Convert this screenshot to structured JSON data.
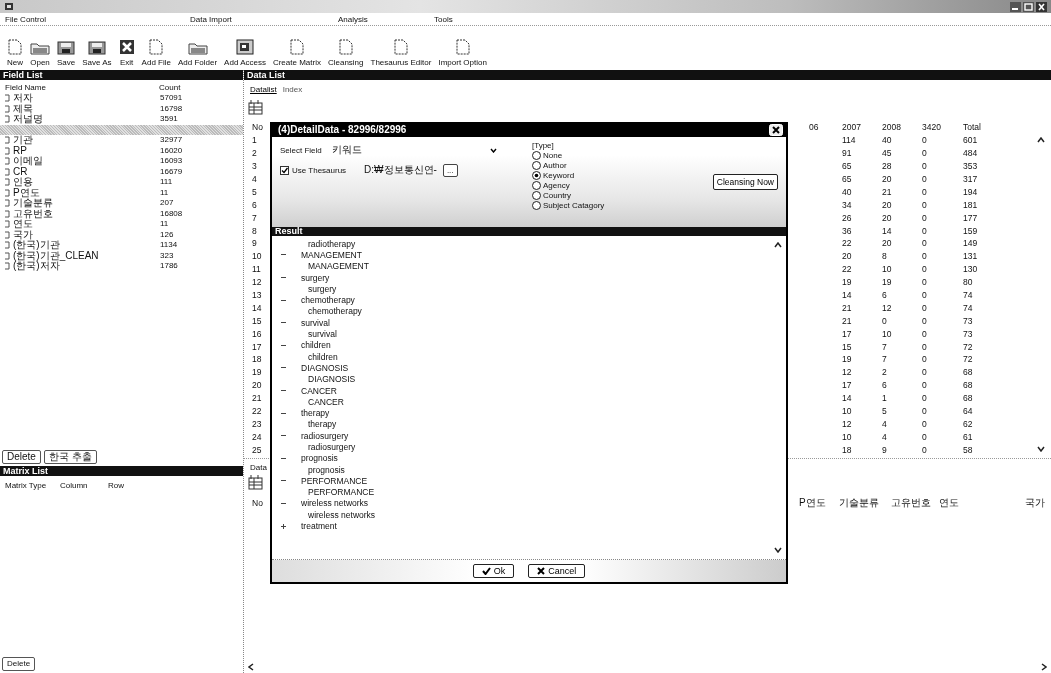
{
  "menu": [
    "File Control",
    "Data Import",
    "Analysis",
    "Tools"
  ],
  "toolbar": [
    {
      "label": "New",
      "kind": "document"
    },
    {
      "label": "Open",
      "kind": "folder"
    },
    {
      "label": "Save",
      "kind": "disk"
    },
    {
      "label": "Save As",
      "kind": "disk"
    },
    {
      "label": "Exit",
      "kind": "exit"
    },
    {
      "label": "Add File",
      "kind": "document"
    },
    {
      "label": "Add Folder",
      "kind": "folder"
    },
    {
      "label": "Add Access",
      "kind": "database"
    },
    {
      "label": "Create Matrix",
      "kind": "document"
    },
    {
      "label": "Cleansing",
      "kind": "document"
    },
    {
      "label": "Thesaurus Editor",
      "kind": "document"
    },
    {
      "label": "Import Option",
      "kind": "document"
    }
  ],
  "field_list": {
    "title": "Field List",
    "columns": [
      "Field Name",
      "Count"
    ],
    "rows": [
      {
        "name": "저자",
        "count": "57091",
        "selected": false
      },
      {
        "name": "제목",
        "count": "16798",
        "selected": false
      },
      {
        "name": "저널명",
        "count": "3591",
        "selected": false
      },
      {
        "selected": true
      },
      {
        "name": "기관",
        "count": "32977",
        "selected": false
      },
      {
        "name": "RP",
        "count": "16020",
        "selected": false
      },
      {
        "name": "이메일",
        "count": "16093",
        "selected": false
      },
      {
        "name": "CR",
        "count": "16679",
        "selected": false
      },
      {
        "name": "인용",
        "count": "111",
        "selected": false
      },
      {
        "name": "P연도",
        "count": "11",
        "selected": false
      },
      {
        "name": "기술분류",
        "count": "207",
        "selected": false
      },
      {
        "name": "고유번호",
        "count": "16808",
        "selected": false
      },
      {
        "name": "연도",
        "count": "11",
        "selected": false
      },
      {
        "name": "국가",
        "count": "126",
        "selected": false
      },
      {
        "name": "(한국)기관",
        "count": "1134",
        "selected": false
      },
      {
        "name": "(한국)기관_CLEAN",
        "count": "323",
        "selected": false
      },
      {
        "name": "(한국)저자",
        "count": "1786",
        "selected": false
      }
    ],
    "buttons": [
      "Delete",
      "한국 추출"
    ]
  },
  "matrix_list": {
    "title": "Matrix List",
    "columns": [
      "Matrix Type",
      "Column",
      "Row"
    ],
    "buttons": [
      "Delete"
    ]
  },
  "data_list": {
    "title": "Data List",
    "tabs": [
      {
        "label": "Datalist",
        "selected": true
      },
      {
        "label": "Index",
        "selected": false
      }
    ],
    "table": {
      "no_column": "No",
      "columns": [
        "06",
        "2007",
        "2008",
        "3420",
        "Total"
      ],
      "rows": [
        {
          "no": "1",
          "cells": [
            "",
            "114",
            "40",
            "0",
            "601"
          ]
        },
        {
          "no": "2",
          "cells": [
            "",
            "91",
            "45",
            "0",
            "484"
          ]
        },
        {
          "no": "3",
          "cells": [
            "",
            "65",
            "28",
            "0",
            "353"
          ]
        },
        {
          "no": "4",
          "cells": [
            "",
            "65",
            "20",
            "0",
            "317"
          ]
        },
        {
          "no": "5",
          "cells": [
            "",
            "40",
            "21",
            "0",
            "194"
          ]
        },
        {
          "no": "6",
          "cells": [
            "",
            "34",
            "20",
            "0",
            "181"
          ]
        },
        {
          "no": "7",
          "cells": [
            "",
            "26",
            "20",
            "0",
            "177"
          ]
        },
        {
          "no": "8",
          "cells": [
            "",
            "36",
            "14",
            "0",
            "159"
          ]
        },
        {
          "no": "9",
          "cells": [
            "",
            "22",
            "20",
            "0",
            "149"
          ]
        },
        {
          "no": "10",
          "cells": [
            "",
            "20",
            "8",
            "0",
            "131"
          ]
        },
        {
          "no": "11",
          "cells": [
            "",
            "22",
            "10",
            "0",
            "130"
          ]
        },
        {
          "no": "12",
          "cells": [
            "",
            "19",
            "19",
            "0",
            "80"
          ]
        },
        {
          "no": "13",
          "cells": [
            "",
            "14",
            "6",
            "0",
            "74"
          ]
        },
        {
          "no": "14",
          "cells": [
            "",
            "21",
            "12",
            "0",
            "74"
          ]
        },
        {
          "no": "15",
          "cells": [
            "",
            "21",
            "0",
            "0",
            "73"
          ]
        },
        {
          "no": "16",
          "cells": [
            "",
            "17",
            "10",
            "0",
            "73"
          ]
        },
        {
          "no": "17",
          "cells": [
            "",
            "15",
            "7",
            "0",
            "72"
          ]
        },
        {
          "no": "18",
          "cells": [
            "",
            "19",
            "7",
            "0",
            "72"
          ]
        },
        {
          "no": "19",
          "cells": [
            "",
            "12",
            "2",
            "0",
            "68"
          ]
        },
        {
          "no": "20",
          "cells": [
            "",
            "17",
            "6",
            "0",
            "68"
          ]
        },
        {
          "no": "21",
          "cells": [
            "",
            "14",
            "1",
            "0",
            "68"
          ]
        },
        {
          "no": "22",
          "cells": [
            "",
            "10",
            "5",
            "0",
            "64"
          ]
        },
        {
          "no": "23",
          "cells": [
            "",
            "12",
            "4",
            "0",
            "62"
          ]
        },
        {
          "no": "24",
          "cells": [
            "",
            "10",
            "4",
            "0",
            "61"
          ]
        },
        {
          "no": "25",
          "cells": [
            "",
            "18",
            "9",
            "0",
            "58"
          ]
        }
      ]
    },
    "second_table": {
      "label": "Data",
      "columns_left": [
        "No"
      ],
      "columns_right": [
        "P연도",
        "기술분류",
        "고유번호",
        "연도",
        "국가"
      ]
    }
  },
  "dialog": {
    "title": "(4)DetailData - 82996/82996",
    "select_field": {
      "label": "Select Field",
      "value": "키워드"
    },
    "use_thesaurus": {
      "label": "Use Thesaurus",
      "checked": true
    },
    "thesaurus_path": "D:₩정보통신연-",
    "browse_button": "...",
    "type_group": {
      "label": "[Type]",
      "options": [
        {
          "label": "None",
          "selected": false
        },
        {
          "label": "Author",
          "selected": false
        },
        {
          "label": "Keyword",
          "selected": true
        },
        {
          "label": "Agency",
          "selected": false
        },
        {
          "label": "Country",
          "selected": false
        },
        {
          "label": "Subject Catagory",
          "selected": false
        }
      ]
    },
    "cleansing_button": "Cleansing Now",
    "result_title": "Result",
    "tree": [
      {
        "children": [
          {
            "label": "radiotherapy"
          }
        ]
      },
      {
        "label": "MANAGEMENT",
        "expanded": true,
        "children": [
          {
            "label": "MANAGEMENT"
          }
        ]
      },
      {
        "label": "surgery",
        "expanded": true,
        "children": [
          {
            "label": "surgery"
          }
        ]
      },
      {
        "label": "chemotherapy",
        "expanded": true,
        "children": [
          {
            "label": "chemotherapy"
          }
        ]
      },
      {
        "label": "survival",
        "expanded": true,
        "children": [
          {
            "label": "survival"
          }
        ]
      },
      {
        "label": "children",
        "expanded": true,
        "children": [
          {
            "label": "children"
          }
        ]
      },
      {
        "label": "DIAGNOSIS",
        "expanded": true,
        "children": [
          {
            "label": "DIAGNOSIS"
          }
        ]
      },
      {
        "label": "CANCER",
        "expanded": true,
        "children": [
          {
            "label": "CANCER"
          }
        ]
      },
      {
        "label": "therapy",
        "expanded": true,
        "children": [
          {
            "label": "therapy"
          }
        ]
      },
      {
        "label": "radiosurgery",
        "expanded": true,
        "children": [
          {
            "label": "radiosurgery"
          }
        ]
      },
      {
        "label": "prognosis",
        "expanded": true,
        "children": [
          {
            "label": "prognosis"
          }
        ]
      },
      {
        "label": "PERFORMANCE",
        "expanded": true,
        "children": [
          {
            "label": "PERFORMANCE"
          }
        ]
      },
      {
        "label": "wireless networks",
        "expanded": true,
        "children": [
          {
            "label": "wireless networks"
          }
        ]
      },
      {
        "label": "treatment",
        "expanded": false
      }
    ],
    "buttons": [
      {
        "label": "Ok",
        "kind": "ok"
      },
      {
        "label": "Cancel",
        "kind": "cancel"
      }
    ]
  }
}
